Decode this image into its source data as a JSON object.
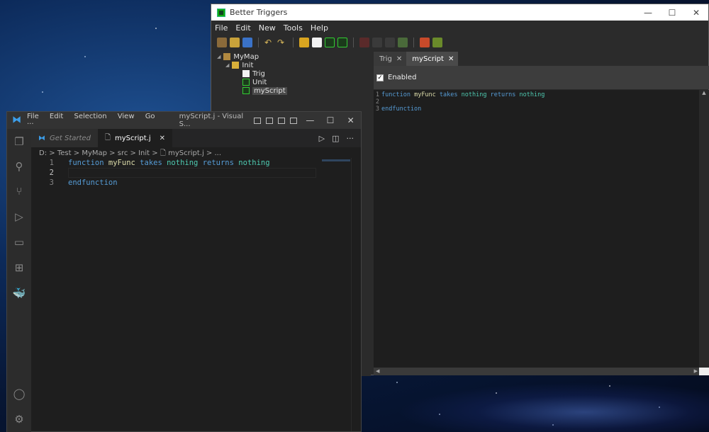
{
  "better_triggers": {
    "title": "Better Triggers",
    "window_controls": {
      "minimize": "—",
      "maximize": "☐",
      "close": "✕"
    },
    "menu": [
      "File",
      "Edit",
      "New",
      "Tools",
      "Help"
    ],
    "tree": {
      "root": "MyMap",
      "folder": "Init",
      "items": [
        "Trig",
        "Unit",
        "myScript"
      ]
    },
    "tabs": [
      {
        "label": "Trig",
        "close": "✕"
      },
      {
        "label": "myScript",
        "close": "✕"
      }
    ],
    "enabled_label": "Enabled",
    "enabled_check": "✓",
    "code": {
      "line_numbers": [
        "1",
        "2",
        "3"
      ],
      "kw_function": "function",
      "func_name": "myFunc",
      "kw_takes": "takes",
      "type_nothing_1": "nothing",
      "kw_returns": "returns",
      "type_nothing_2": "nothing",
      "kw_endfunction": "endfunction"
    },
    "scroll_arrows": {
      "up": "▲",
      "left": "◀",
      "right": "▶"
    }
  },
  "vscode": {
    "menu": [
      "File",
      "Edit",
      "Selection",
      "View",
      "Go",
      "···"
    ],
    "window_title": "myScript.j - Visual S...",
    "window_controls": {
      "minimize": "—",
      "maximize": "☐",
      "close": "✕"
    },
    "logo_glyph": "⧓",
    "tabs": [
      {
        "label": "Get Started",
        "icon": "⧓"
      },
      {
        "label": "myScript.j",
        "icon": "🗋",
        "close": "✕"
      }
    ],
    "tab_actions": {
      "run": "▷",
      "split": "◫",
      "more": "···"
    },
    "breadcrumb": [
      "D:",
      "Test",
      "MyMap",
      "src",
      "Init",
      "myScript.j",
      "..."
    ],
    "breadcrumb_sep": ">",
    "code": {
      "line_numbers": [
        "1",
        "2",
        "3"
      ],
      "kw_function": "function",
      "func_name": "myFunc",
      "kw_takes": "takes",
      "type_nothing_1": "nothing",
      "kw_returns": "returns",
      "type_nothing_2": "nothing",
      "kw_endfunction": "endfunction"
    },
    "activity_icons": [
      {
        "name": "explorer-icon",
        "glyph": "❐"
      },
      {
        "name": "search-icon",
        "glyph": "⚲"
      },
      {
        "name": "source-control-icon",
        "glyph": "⑂"
      },
      {
        "name": "run-debug-icon",
        "glyph": "▷"
      },
      {
        "name": "remote-explorer-icon",
        "glyph": "▭"
      },
      {
        "name": "extensions-icon",
        "glyph": "⊞"
      },
      {
        "name": "docker-icon",
        "glyph": "🐳"
      }
    ],
    "account_glyph": "◯",
    "settings_glyph": "⚙"
  },
  "colors": {
    "keyword": "#569cd6",
    "function": "#dcdcaa",
    "type": "#4ec9b0"
  }
}
